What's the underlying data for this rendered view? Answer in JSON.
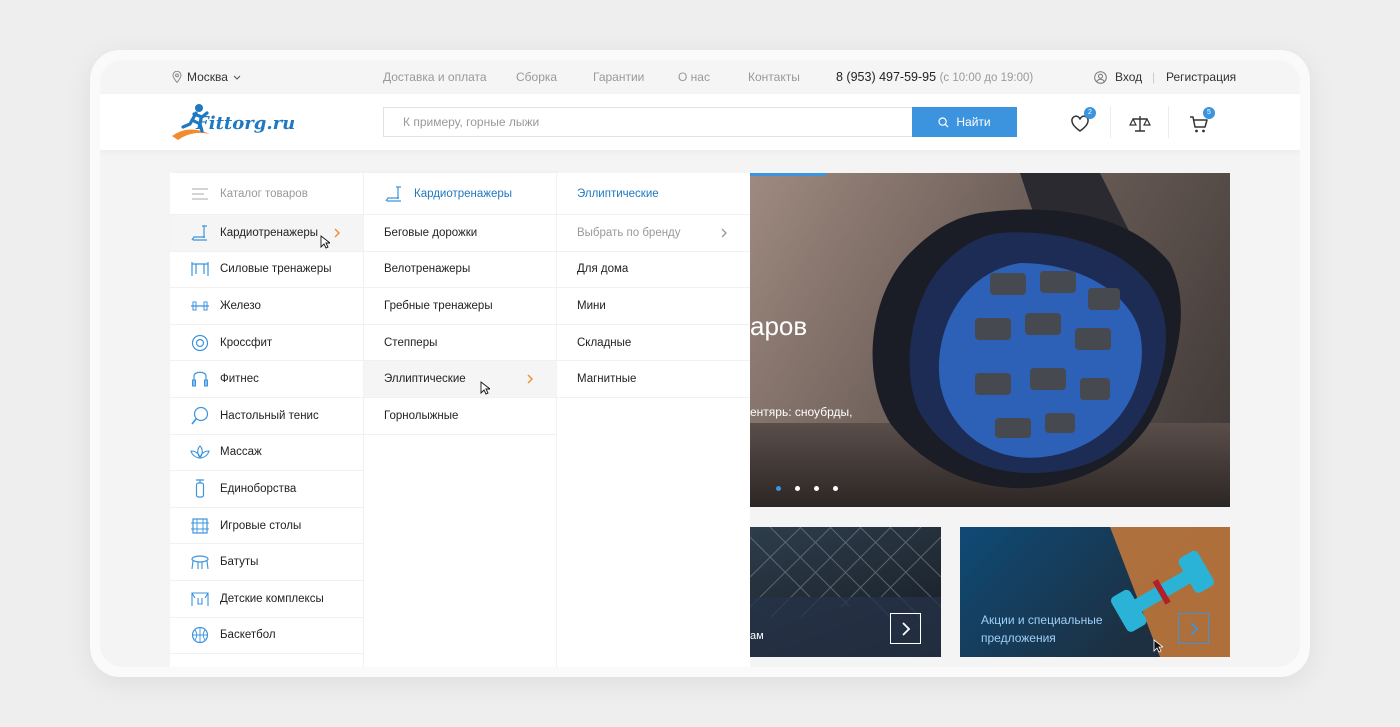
{
  "topbar": {
    "city": "Москва",
    "nav": [
      "Доставка и оплата",
      "Сборка",
      "Гарантии",
      "О нас",
      "Контакты"
    ],
    "phone": "8 (953) 497-59-95",
    "hours": "(с 10:00 до 19:00)",
    "login": "Вход",
    "separator": "|",
    "register": "Регистрация"
  },
  "header": {
    "logo_text": "Fittorg.ru",
    "search_placeholder": "К примеру, горные лыжи",
    "search_button": "Найти",
    "favorites_count": "2",
    "cart_count": "5"
  },
  "catalog": {
    "title": "Каталог товаров",
    "items": [
      {
        "label": "Кардиотренажеры",
        "icon": "treadmill-icon"
      },
      {
        "label": "Силовые тренажеры",
        "icon": "power-rack-icon"
      },
      {
        "label": "Железо",
        "icon": "dumbbell-icon"
      },
      {
        "label": "Кроссфит",
        "icon": "tire-icon"
      },
      {
        "label": "Фитнес",
        "icon": "jump-rope-icon"
      },
      {
        "label": "Настольный тенис",
        "icon": "racket-icon"
      },
      {
        "label": "Массаж",
        "icon": "lotus-icon"
      },
      {
        "label": "Единоборства",
        "icon": "punching-bag-icon"
      },
      {
        "label": "Игровые столы",
        "icon": "foosball-icon"
      },
      {
        "label": "Батуты",
        "icon": "trampoline-icon"
      },
      {
        "label": "Детские комплексы",
        "icon": "playground-icon"
      },
      {
        "label": "Баскетбол",
        "icon": "basketball-icon"
      }
    ]
  },
  "subcatalog": {
    "title": "Кардиотренажеры",
    "items": [
      "Беговые дорожки",
      "Велотренажеры",
      "Гребные тренажеры",
      "Степперы",
      "Эллиптические",
      "Горнолыжные"
    ]
  },
  "subsubcatalog": {
    "title": "Эллиптические",
    "brand_filter": "Выбрать по бренду",
    "items": [
      "Для дома",
      "Мини",
      "Складные",
      "Магнитные"
    ]
  },
  "hero": {
    "title_fragment": "аров",
    "subtitle_fragment": "ентярь: сноубрды,",
    "slides": 4,
    "active_slide": 1
  },
  "banners": [
    {
      "text": "ам"
    },
    {
      "text": "Акции и специальные предложения"
    }
  ],
  "colors": {
    "accent": "#3c94de",
    "orange": "#f28a2e",
    "link_blue": "#1e78c2"
  }
}
